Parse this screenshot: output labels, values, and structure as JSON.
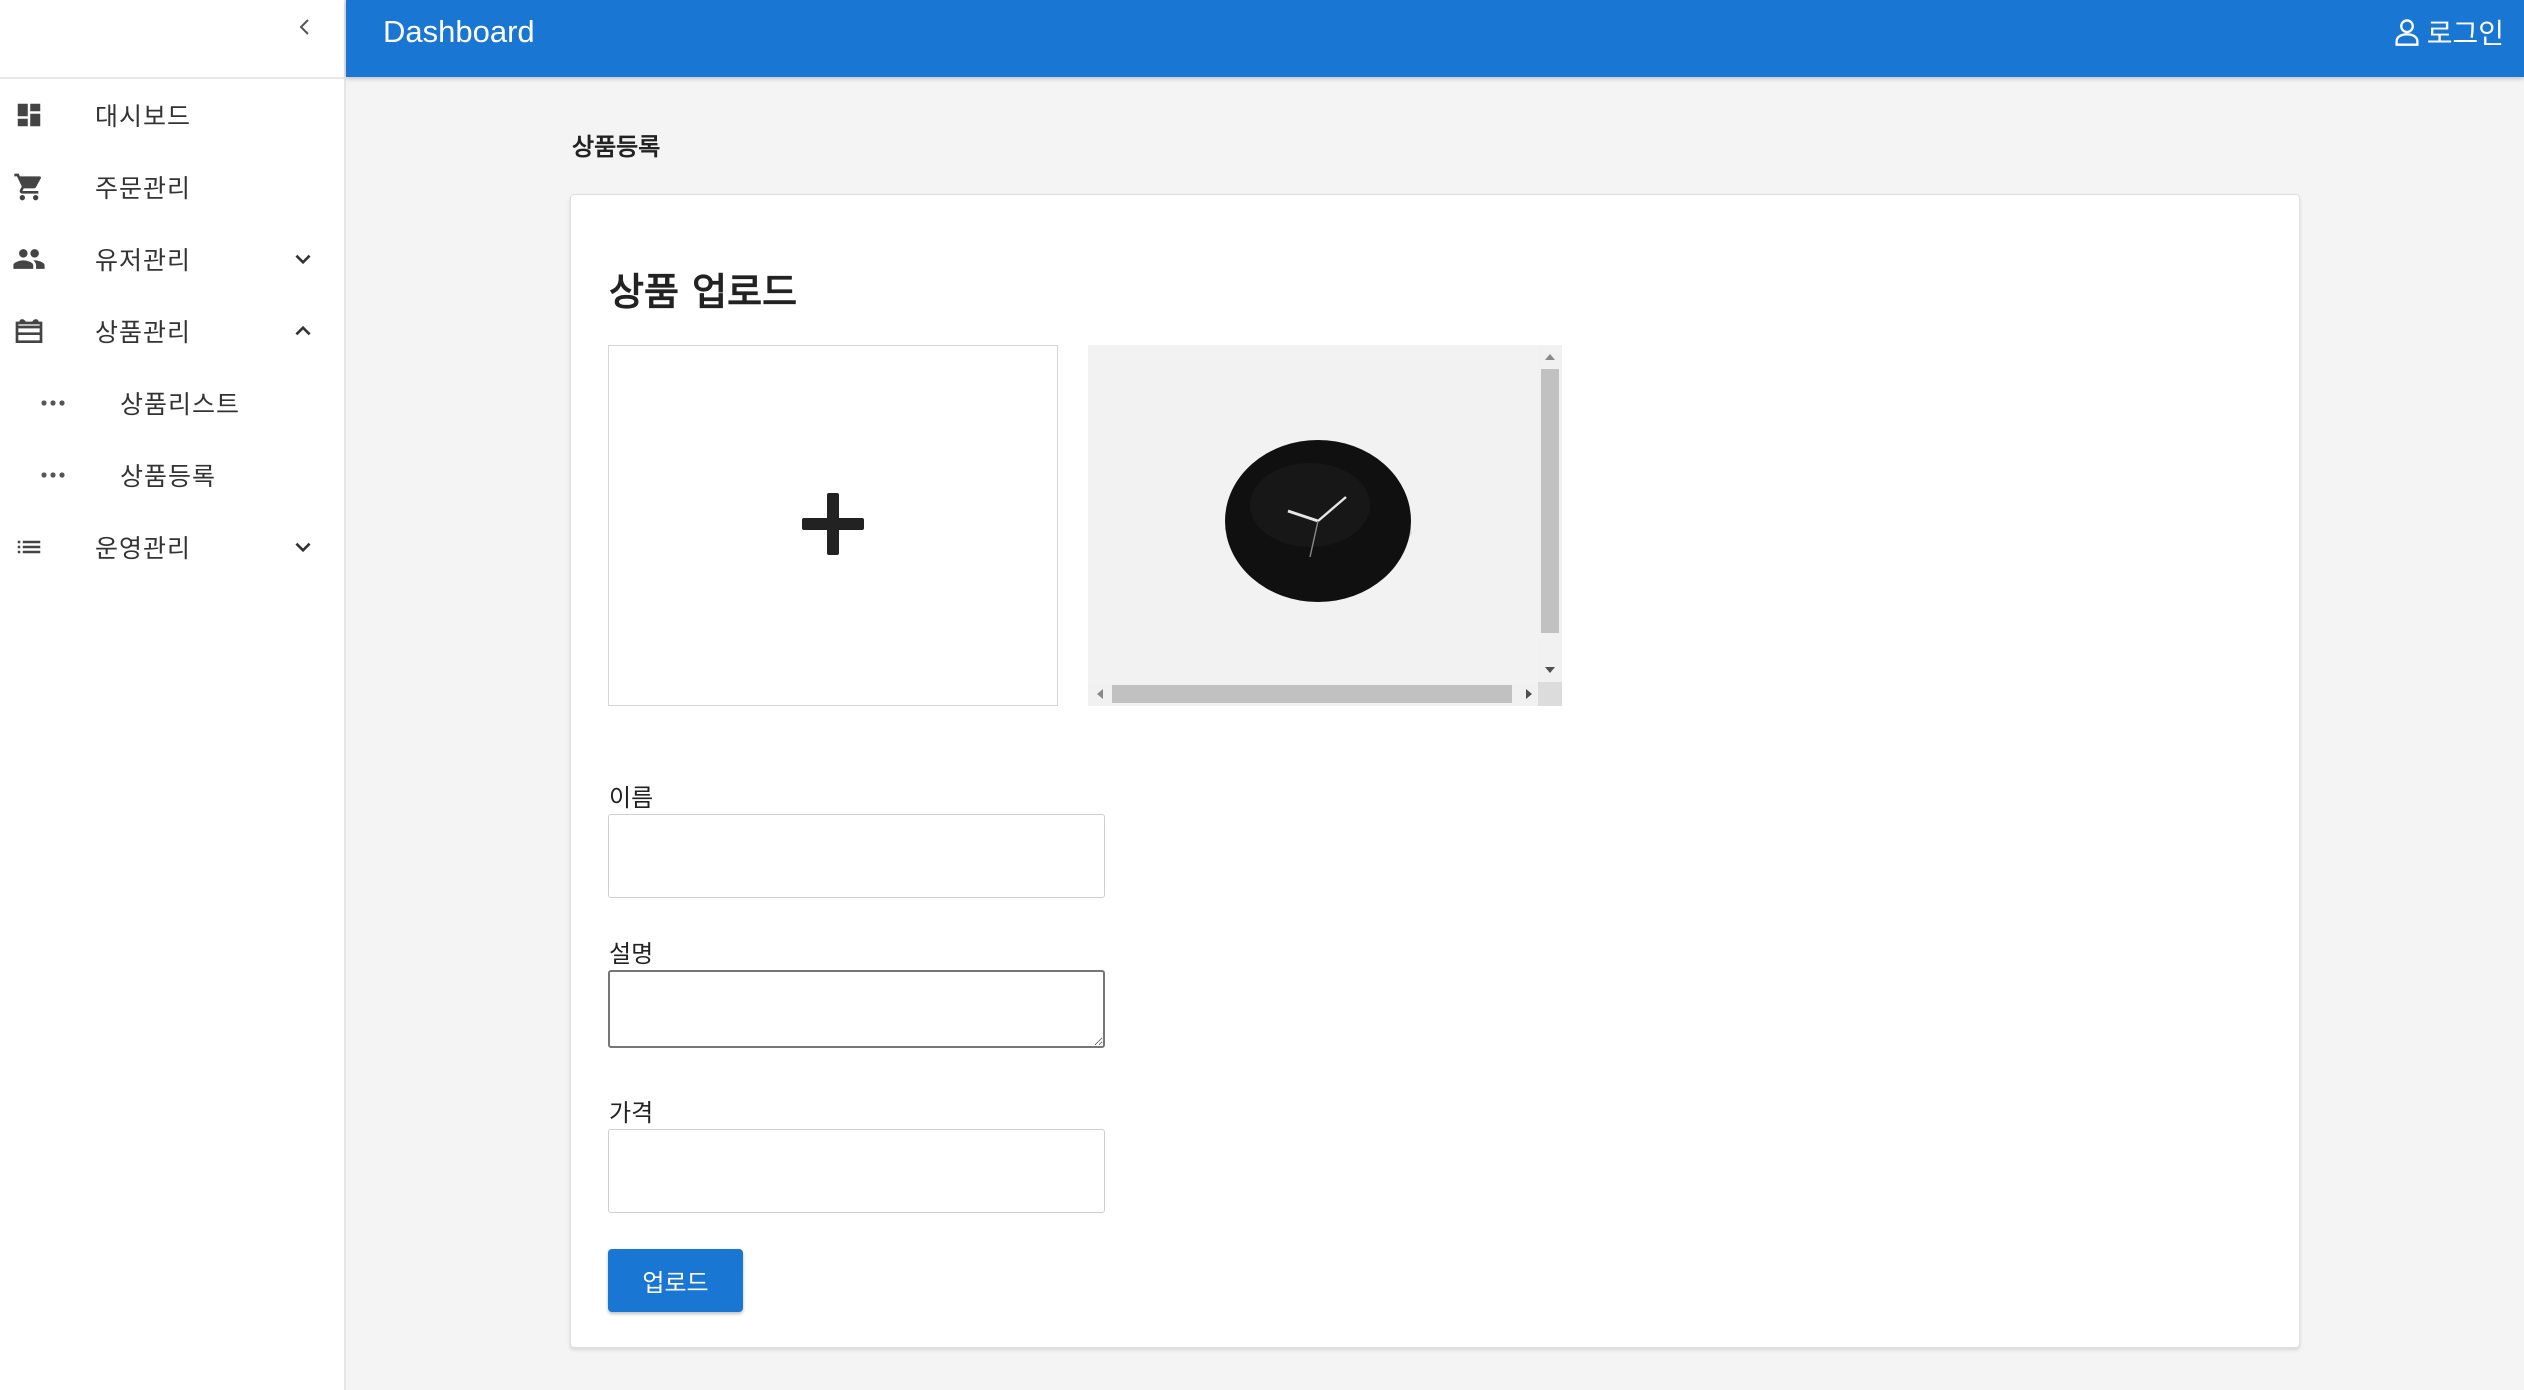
{
  "app": {
    "title": "Dashboard",
    "accent_color": "#1976d2"
  },
  "header": {
    "login_label": "로그인",
    "login_icon": "user-icon"
  },
  "sidebar": {
    "collapse_icon": "chevron-left-icon",
    "items": [
      {
        "label": "대시보드",
        "icon": "dashboard-icon"
      },
      {
        "label": "주문관리",
        "icon": "cart-icon"
      },
      {
        "label": "유저관리",
        "icon": "people-icon",
        "expandable": true,
        "expanded": false
      },
      {
        "label": "상품관리",
        "icon": "gift-icon",
        "expandable": true,
        "expanded": true,
        "children": [
          {
            "label": "상품리스트",
            "icon": "more-horizontal-icon"
          },
          {
            "label": "상품등록",
            "icon": "more-horizontal-icon"
          }
        ]
      },
      {
        "label": "운영관리",
        "icon": "list-icon",
        "expandable": true,
        "expanded": false
      }
    ]
  },
  "page": {
    "title": "상품등록"
  },
  "form": {
    "heading": "상품 업로드",
    "upload_icon": "plus-icon",
    "preview_image": "wall-clock-image",
    "name_label": "이름",
    "name_value": "",
    "description_label": "설명",
    "description_value": "",
    "price_label": "가격",
    "price_value": "",
    "submit_label": "업로드"
  }
}
